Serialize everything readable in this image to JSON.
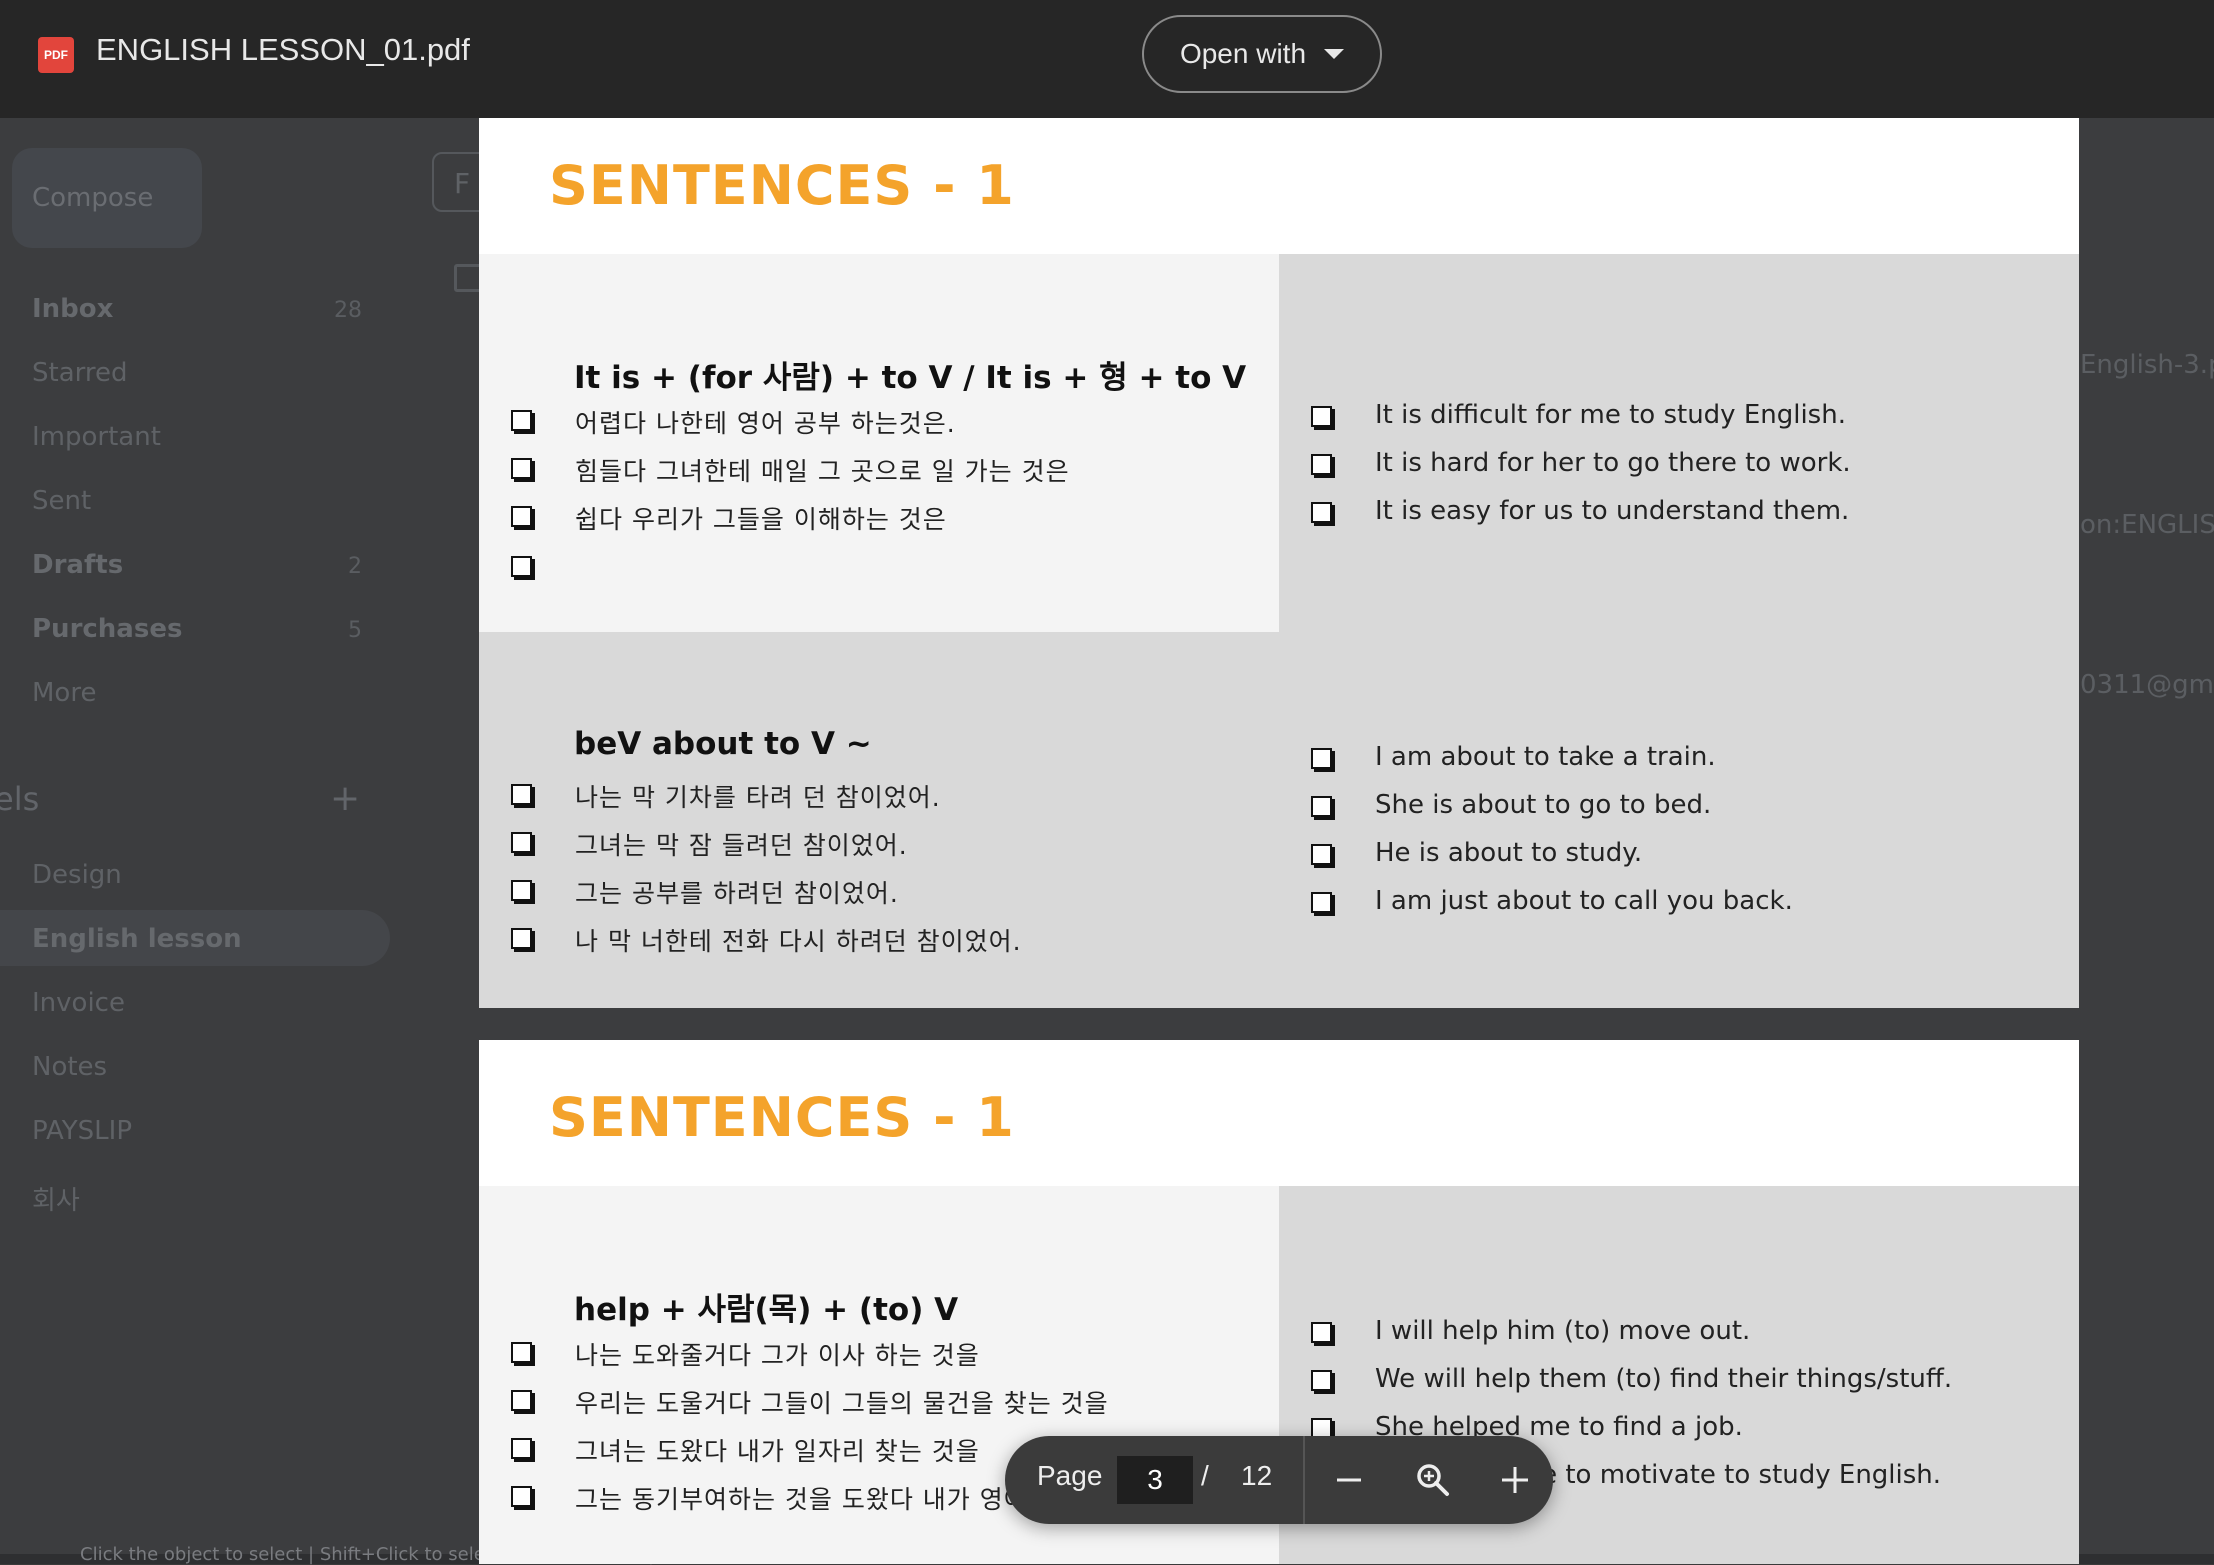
{
  "file": {
    "icon_label": "PDF",
    "name": "ENGLISH LESSON_01.pdf"
  },
  "toolbar": {
    "open_with": "Open with"
  },
  "background": {
    "compose": "Compose",
    "nav": [
      {
        "label": "Inbox",
        "count": "28"
      },
      {
        "label": "Starred",
        "count": ""
      },
      {
        "label": "Important",
        "count": ""
      },
      {
        "label": "Sent",
        "count": ""
      },
      {
        "label": "Drafts",
        "count": "2"
      },
      {
        "label": "Purchases",
        "count": "5"
      },
      {
        "label": "More",
        "count": ""
      }
    ],
    "labels_heading": "els",
    "labels": [
      "Design",
      "English lesson",
      "Invoice",
      "Notes",
      "PAYSLIP",
      "회사"
    ],
    "snippets": [
      "English-3.p",
      "on:ENGLIS",
      "0311@gm"
    ],
    "status": "Click the object to select | Shift+Click to select multiple object | Option+Drag the object to duplicate"
  },
  "pages": [
    {
      "title": "SENTENCES - 1",
      "sections": [
        {
          "heading": "It is + (for 사람) + to V / It is + 형 + to V",
          "korean": [
            "어렵다 나한테 영어 공부 하는것은.",
            "힘들다 그녀한테 매일 그 곳으로 일 가는 것은",
            "쉽다 우리가 그들을 이해하는 것은",
            ""
          ],
          "english": [
            "It is difficult for me to study English.",
            "It is hard for her to go there to work.",
            "It is easy for us to understand them."
          ]
        },
        {
          "heading": "beV about to V ~",
          "korean": [
            "나는 막 기차를 타려 던 참이었어.",
            "그녀는 막 잠 들려던 참이었어.",
            "그는 공부를 하려던 참이었어.",
            "나 막 너한테 전화 다시 하려던 참이었어."
          ],
          "english": [
            "I am about to take a train.",
            "She is about to go to bed.",
            "He is about to study.",
            "I am just about to call you back."
          ]
        }
      ]
    },
    {
      "title": "SENTENCES - 1",
      "sections": [
        {
          "heading": "help + 사람(목) + (to) V",
          "korean": [
            "나는 도와줄거다 그가 이사 하는 것을",
            "우리는 도울거다 그들이 그들의 물건을 찾는 것을",
            "그녀는 도왔다 내가 일자리 찾는 것을",
            "그는 동기부여하는 것을 도왔다 내가 영어 공부 할 것을"
          ],
          "english": [
            "I will help him (to) move out.",
            "We will help them (to) find their things/stuff.",
            "She helped me to find a job.",
            "He helped me to motivate to study English."
          ]
        }
      ]
    }
  ],
  "pager": {
    "label": "Page",
    "current": "3",
    "separator": "/",
    "total": "12"
  }
}
